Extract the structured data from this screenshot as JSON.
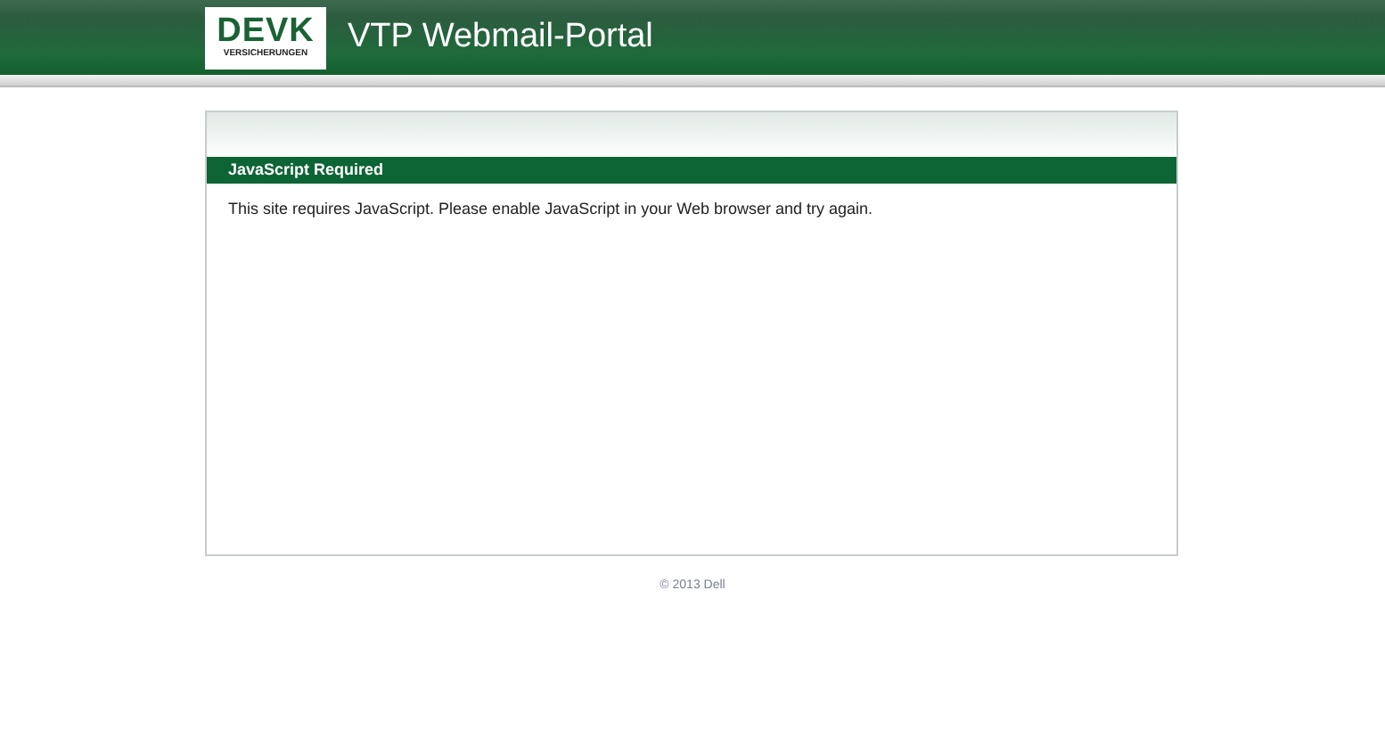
{
  "header": {
    "logo": {
      "name": "DEVK",
      "subtitle": "VERSICHERUNGEN"
    },
    "title": "VTP Webmail-Portal"
  },
  "panel": {
    "heading": "JavaScript Required",
    "message": "This site requires JavaScript. Please enable JavaScript in your Web browser and try again."
  },
  "footer": "© 2013 Dell"
}
